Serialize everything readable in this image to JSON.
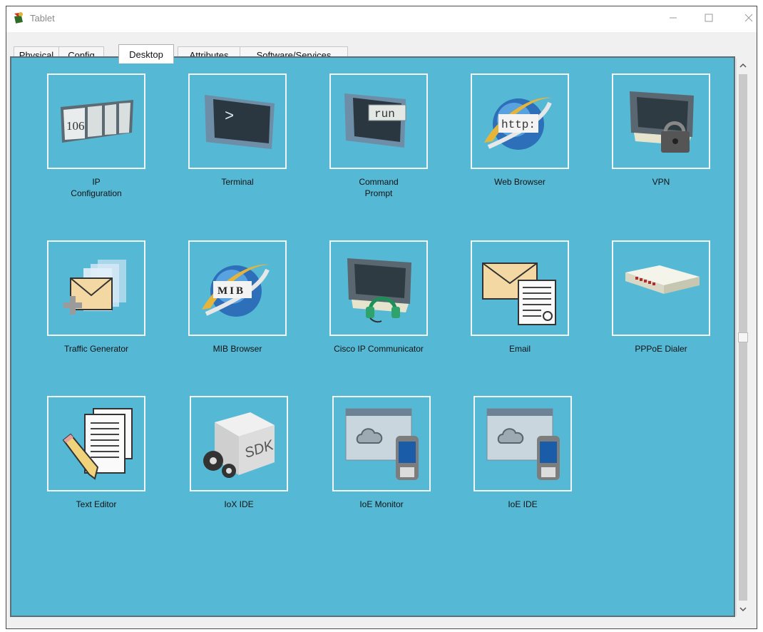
{
  "window": {
    "title": "Tablet",
    "icon": "tablet-app-icon"
  },
  "controls": {
    "minimize": "—",
    "maximize": "☐",
    "close": "✕"
  },
  "tabs": [
    {
      "label": "Physical"
    },
    {
      "label": "Config"
    },
    {
      "label": "Desktop"
    },
    {
      "label": "Attributes"
    },
    {
      "label": "Software/Services"
    }
  ],
  "active_tab": "Desktop",
  "apps": [
    {
      "label": "IP\nConfiguration",
      "icon": "ip-configuration-icon",
      "badge": "106"
    },
    {
      "label": "Terminal",
      "icon": "terminal-icon",
      "badge": ">"
    },
    {
      "label": "Command\nPrompt",
      "icon": "command-prompt-icon",
      "badge": "run"
    },
    {
      "label": "Web Browser",
      "icon": "web-browser-icon",
      "badge": "http:"
    },
    {
      "label": "VPN",
      "icon": "vpn-icon"
    },
    {
      "label": "Traffic Generator",
      "icon": "traffic-generator-icon"
    },
    {
      "label": "MIB Browser",
      "icon": "mib-browser-icon",
      "badge": "MIB"
    },
    {
      "label": "Cisco IP Communicator",
      "icon": "ip-communicator-icon"
    },
    {
      "label": "Email",
      "icon": "email-icon"
    },
    {
      "label": "PPPoE Dialer",
      "icon": "pppoe-dialer-icon"
    },
    {
      "label": "Text Editor",
      "icon": "text-editor-icon"
    },
    {
      "label": "IoX IDE",
      "icon": "iox-ide-icon",
      "badge": "SDK"
    },
    {
      "label": "IoE Monitor",
      "icon": "ioe-monitor-icon"
    },
    {
      "label": "IoE IDE",
      "icon": "ioe-ide-icon"
    }
  ],
  "colors": {
    "desktop_bg": "#55b9d6",
    "tile_border": "#f2f4f4",
    "window_border": "#4a4a4a"
  }
}
